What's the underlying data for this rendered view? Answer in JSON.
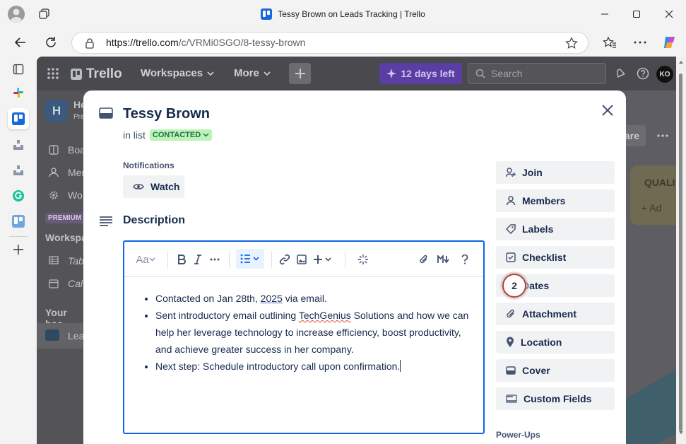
{
  "browser": {
    "window_title": "Tessy Brown on Leads Tracking | Trello",
    "url_host": "https://trello.com",
    "url_path": "/c/VRMi0SGO/8-tessy-brown"
  },
  "trello_nav": {
    "logo": "Trello",
    "workspaces": "Workspaces",
    "more": "More",
    "trial": "12 days left",
    "search_placeholder": "Search",
    "avatar": "KO"
  },
  "sidebar": {
    "workspace_initial": "H",
    "workspace_name": "He",
    "workspace_sub": "Pre",
    "items": [
      "Boa",
      "Mem",
      "Wo"
    ],
    "premium": "PREMIUM",
    "section": "Workspa",
    "views": [
      "Tab",
      "Cal"
    ],
    "your_boards": "Your boa",
    "board": "Lea"
  },
  "board": {
    "share": "are",
    "list_name": "QUALI",
    "add": "+ Ad"
  },
  "card": {
    "title": "Tessy Brown",
    "in_list": "in list",
    "list_status": "CONTACTED",
    "notifications_label": "Notifications",
    "watch": "Watch",
    "description_title": "Description",
    "toolbar_text_style": "Aa",
    "description_items": [
      {
        "pre": "Contacted on Jan 28th, ",
        "u": "2025",
        "post": " via email."
      },
      {
        "pre": "Sent introductory email outlining ",
        "u": "TechGenius",
        "post": " Solutions and how we can help her leverage technology to increase efficiency, boost productivity, and achieve greater success in her company."
      },
      {
        "pre": "Next step: Schedule introductory call upon confirmation.",
        "u": "",
        "post": ""
      }
    ],
    "actions": [
      "Join",
      "Members",
      "Labels",
      "Checklist",
      "Dates",
      "Attachment",
      "Location",
      "Cover",
      "Custom Fields"
    ],
    "powerups": "Power-Ups",
    "annotation_badge": "2"
  }
}
